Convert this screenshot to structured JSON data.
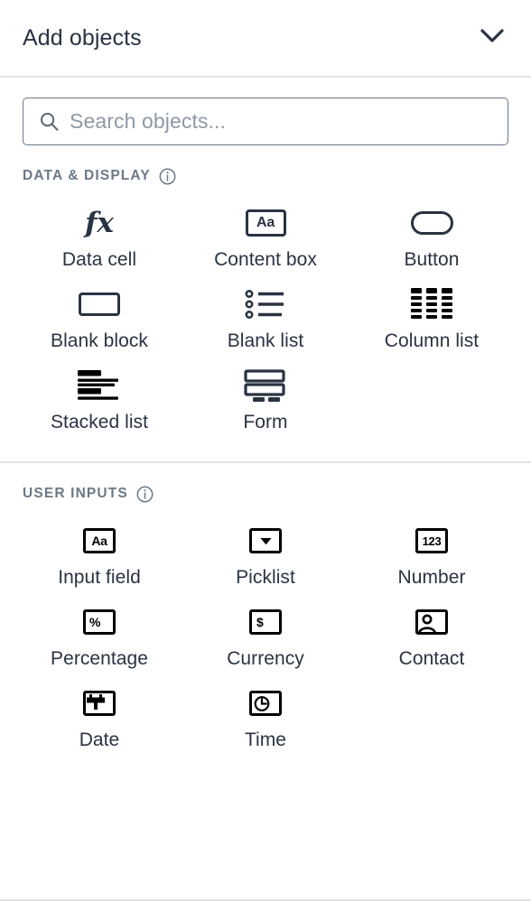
{
  "header": {
    "title": "Add objects",
    "collapse_icon": "chevron-down-icon"
  },
  "search": {
    "placeholder": "Search objects...",
    "value": "",
    "icon": "search-icon"
  },
  "sections": [
    {
      "title": "DATA & DISPLAY",
      "info_icon": "info-circle-icon",
      "items": [
        {
          "label": "Data cell",
          "icon": "function-fx-icon"
        },
        {
          "label": "Content box",
          "icon": "text-box-aa-icon"
        },
        {
          "label": "Button",
          "icon": "rounded-pill-button-icon"
        },
        {
          "label": "Blank block",
          "icon": "rectangle-block-icon"
        },
        {
          "label": "Blank list",
          "icon": "bulleted-list-icon"
        },
        {
          "label": "Column list",
          "icon": "column-grid-icon"
        },
        {
          "label": "Stacked list",
          "icon": "stacked-bars-icon"
        },
        {
          "label": "Form",
          "icon": "form-fields-icon"
        }
      ]
    },
    {
      "title": "USER INPUTS",
      "info_icon": "info-circle-icon",
      "items": [
        {
          "label": "Input field",
          "icon": "text-input-aa-icon",
          "glyph": "Aa"
        },
        {
          "label": "Picklist",
          "icon": "dropdown-caret-icon",
          "glyph": ""
        },
        {
          "label": "Number",
          "icon": "number-123-icon",
          "glyph": "123"
        },
        {
          "label": "Percentage",
          "icon": "percent-icon",
          "glyph": "%"
        },
        {
          "label": "Currency",
          "icon": "dollar-currency-icon",
          "glyph": "$"
        },
        {
          "label": "Contact",
          "icon": "contact-person-icon",
          "glyph": ""
        },
        {
          "label": "Date",
          "icon": "calendar-icon",
          "glyph": ""
        },
        {
          "label": "Time",
          "icon": "clock-icon",
          "glyph": ""
        }
      ]
    }
  ],
  "colors": {
    "text": "#2a3342",
    "muted": "#6b7886",
    "placeholder": "#8d98a5",
    "border": "#dfe3e8",
    "icon_dark": "#000000"
  }
}
